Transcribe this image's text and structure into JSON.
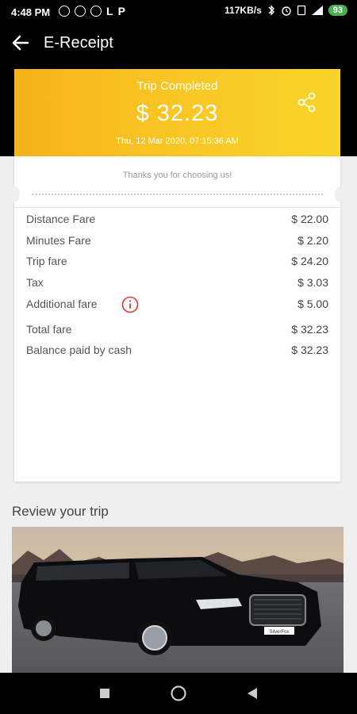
{
  "status_bar": {
    "time": "4:48 PM",
    "p_label": "P",
    "network_speed": "117KB/s",
    "battery": "93"
  },
  "app_bar": {
    "back_icon": "arrow-left-icon",
    "title": "E-Receipt"
  },
  "trip_header": {
    "status": "Trip Completed",
    "amount": "$  32.23",
    "date": "Thu, 12 Mar 2020, 07:15:36 AM",
    "share_icon": "share-icon"
  },
  "receipt": {
    "thanks_text": "Thanks you for choosing us!",
    "rows": [
      {
        "label": "Distance Fare",
        "value": "$ 22.00"
      },
      {
        "label": "Minutes Fare",
        "value": "$ 2.20"
      },
      {
        "label": "Trip fare",
        "value": "$ 24.20"
      },
      {
        "label": "Tax",
        "value": "$ 3.03"
      },
      {
        "label": "Additional fare",
        "value": "$ 5.00"
      },
      {
        "label": "Total fare",
        "value": "$  32.23"
      },
      {
        "label": "Balance paid by cash",
        "value": "$ 32.23"
      }
    ]
  },
  "review": {
    "title": "Review your trip",
    "plate_text": "SilverFox"
  },
  "colors": {
    "header_gradient_start": "#f6b31b",
    "header_gradient_end": "#f8d52b",
    "info_icon": "#e53935"
  }
}
